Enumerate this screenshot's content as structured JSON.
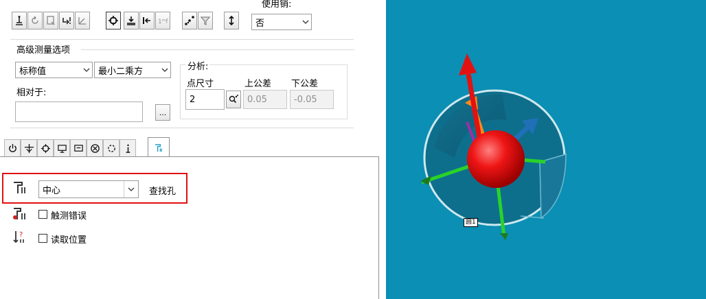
{
  "toolbar": {
    "use_pin_label": "使用销:",
    "use_pin_value": "否"
  },
  "advanced": {
    "group_title": "高级测量选项",
    "combo1": "标称值",
    "combo2": "最小二乘方",
    "relative_to_label": "相对于:",
    "relative_to_value": "",
    "browse_label": "..."
  },
  "analysis": {
    "title": "分析:",
    "point_size_label": "点尺寸",
    "point_size_value": "2",
    "upper_tol_label": "上公差",
    "upper_tol_value": "0.05",
    "lower_tol_label": "下公差",
    "lower_tol_value": "-0.05"
  },
  "tabpage": {
    "find_hole_combo": "中心",
    "find_hole_label": "查找孔",
    "touch_error_label": "触测错误",
    "read_position_label": "读取位置"
  },
  "viewport": {
    "feature_label": "圆1",
    "background_color": "#0b8fb4"
  },
  "colors": {
    "highlight_box": "#e01010"
  }
}
